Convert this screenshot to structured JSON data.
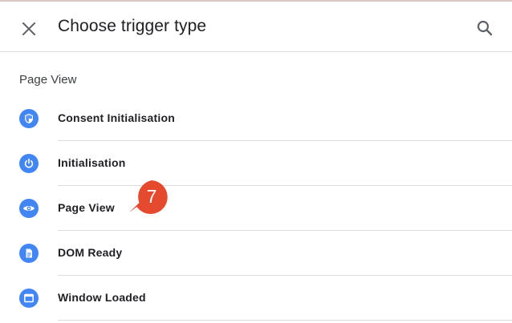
{
  "header": {
    "title": "Choose trigger type",
    "close_icon": "close-icon",
    "search_icon": "search-icon"
  },
  "section": {
    "label": "Page View"
  },
  "items": [
    {
      "label": "Consent Initialisation",
      "icon": "shield-icon"
    },
    {
      "label": "Initialisation",
      "icon": "power-icon"
    },
    {
      "label": "Page View",
      "icon": "eye-icon"
    },
    {
      "label": "DOM Ready",
      "icon": "document-icon"
    },
    {
      "label": "Window Loaded",
      "icon": "window-icon"
    }
  ],
  "callout": {
    "number": "7",
    "color": "#e64a2e"
  },
  "colors": {
    "accent": "#4285f4",
    "divider": "#dadce0"
  }
}
